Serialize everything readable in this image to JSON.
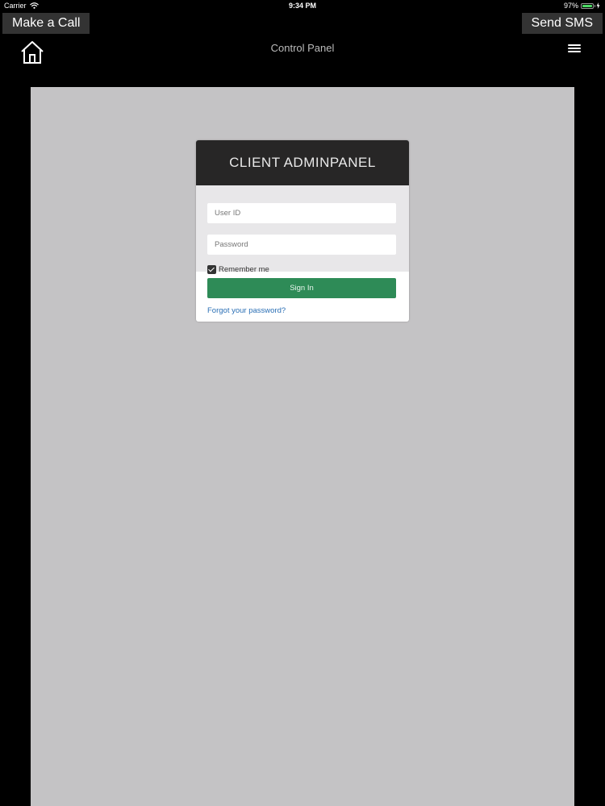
{
  "status_bar": {
    "carrier": "Carrier",
    "time": "9:34 PM",
    "battery_percent": "97%",
    "battery_level": 0.97,
    "wifi_icon": "wifi-icon",
    "battery_icon": "battery-icon",
    "charging_icon": "charging-icon"
  },
  "top_buttons": {
    "call_label": "Make a Call",
    "sms_label": "Send SMS"
  },
  "navbar": {
    "title": "Control Panel",
    "home_icon": "home-icon",
    "menu_icon": "hamburger-menu-icon"
  },
  "login": {
    "header": "CLIENT ADMINPANEL",
    "user_id_placeholder": "User ID",
    "user_id_value": "",
    "password_placeholder": "Password",
    "password_value": "",
    "remember_label": "Remember me",
    "remember_checked": true,
    "signin_label": "Sign In",
    "forgot_link": "Forgot your password?"
  },
  "colors": {
    "background": "#000000",
    "content": "#c4c3c5",
    "header": "#272626",
    "signin": "#2e8b57",
    "link": "#2a6fb5"
  }
}
